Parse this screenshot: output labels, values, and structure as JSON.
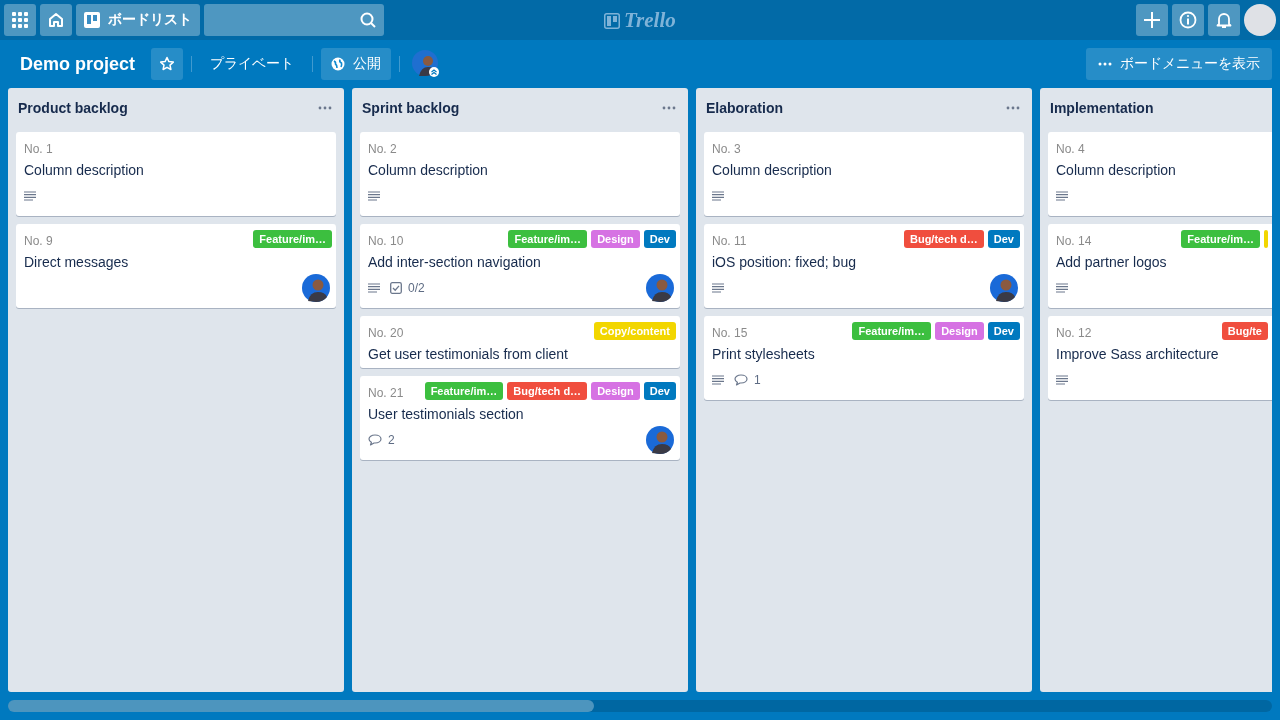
{
  "topbar": {
    "boards_button": "ボードリスト",
    "logo": "Trello"
  },
  "board_header": {
    "title": "Demo project",
    "starred": false,
    "visibility": "プライベート",
    "public_button": "公開",
    "menu_button": "ボードメニューを表示"
  },
  "lists": [
    {
      "title": "Product backlog",
      "menu": true,
      "cards": [
        {
          "number": "No. 1",
          "title": "Column description",
          "badges": [
            {
              "kind": "description"
            }
          ],
          "avatar": false
        },
        {
          "number": "No. 9",
          "title": "Direct messages",
          "labels": [
            {
              "text": "Feature/im…",
              "color": "#3cbf3f"
            }
          ],
          "avatar": true
        }
      ]
    },
    {
      "title": "Sprint backlog",
      "menu": true,
      "cards": [
        {
          "number": "No. 2",
          "title": "Column description",
          "badges": [
            {
              "kind": "description"
            }
          ],
          "avatar": false
        },
        {
          "number": "No. 10",
          "title": "Add inter-section navigation",
          "labels": [
            {
              "text": "Feature/im…",
              "color": "#3cbf3f"
            },
            {
              "text": "Design",
              "color": "#d672e3"
            },
            {
              "text": "Dev",
              "color": "#0079bf"
            }
          ],
          "badges": [
            {
              "kind": "description"
            },
            {
              "kind": "checklist",
              "text": "0/2"
            }
          ],
          "avatar": true
        },
        {
          "number": "No. 20",
          "title": "Get user testimonials from client",
          "labels": [
            {
              "text": "Copy/content",
              "color": "#f2d600"
            }
          ],
          "avatar": false
        },
        {
          "number": "No. 21",
          "title": "User testimonials section",
          "labels": [
            {
              "text": "Feature/im…",
              "color": "#3cbf3f"
            },
            {
              "text": "Bug/tech d…",
              "color": "#f04e3e"
            },
            {
              "text": "Design",
              "color": "#d672e3"
            },
            {
              "text": "Dev",
              "color": "#0079bf"
            }
          ],
          "badges": [
            {
              "kind": "comments",
              "text": "2"
            }
          ],
          "avatar": true
        }
      ]
    },
    {
      "title": "Elaboration",
      "menu": true,
      "cards": [
        {
          "number": "No. 3",
          "title": "Column description",
          "badges": [
            {
              "kind": "description"
            }
          ],
          "avatar": false
        },
        {
          "number": "No. 11",
          "title": "iOS position: fixed; bug",
          "labels": [
            {
              "text": "Bug/tech d…",
              "color": "#f04e3e"
            },
            {
              "text": "Dev",
              "color": "#0079bf"
            }
          ],
          "badges": [
            {
              "kind": "description"
            }
          ],
          "avatar": true
        },
        {
          "number": "No. 15",
          "title": "Print stylesheets",
          "labels": [
            {
              "text": "Feature/im…",
              "color": "#3cbf3f"
            },
            {
              "text": "Design",
              "color": "#d672e3"
            },
            {
              "text": "Dev",
              "color": "#0079bf"
            }
          ],
          "badges": [
            {
              "kind": "description"
            },
            {
              "kind": "comments",
              "text": "1"
            }
          ],
          "avatar": false
        }
      ]
    },
    {
      "title": "Implementation",
      "menu": false,
      "cards": [
        {
          "number": "No. 4",
          "title": "Column description",
          "badges": [
            {
              "kind": "description"
            }
          ],
          "avatar": false
        },
        {
          "number": "No. 14",
          "title": "Add partner logos",
          "labels": [
            {
              "text": "Feature/im…",
              "color": "#3cbf3f"
            },
            {
              "color": "#f2d600"
            }
          ],
          "badges": [
            {
              "kind": "description"
            }
          ],
          "avatar": false
        },
        {
          "number": "No. 12",
          "title": "Improve Sass architecture",
          "labels": [
            {
              "text": "Bug/te",
              "color": "#f04e3e"
            }
          ],
          "badges": [
            {
              "kind": "description"
            }
          ],
          "avatar": false
        }
      ]
    }
  ]
}
